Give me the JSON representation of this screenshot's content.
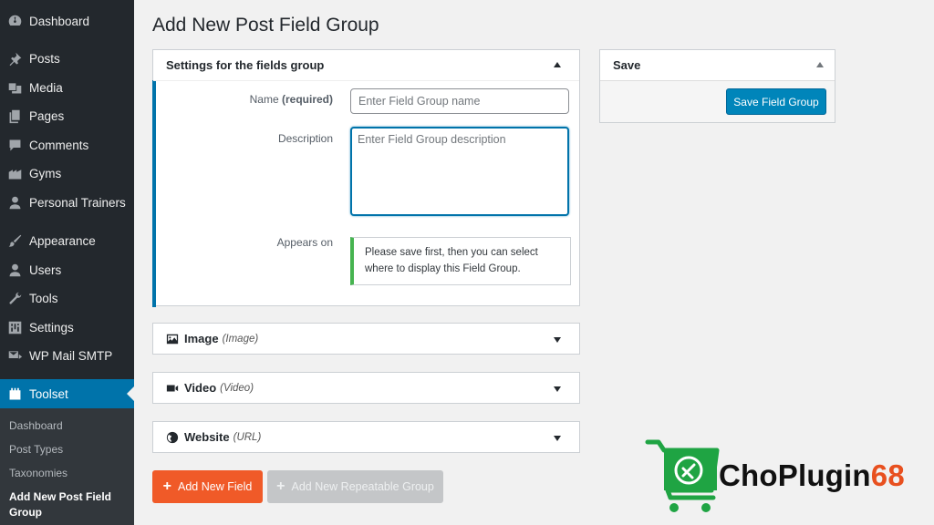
{
  "sidebar": {
    "items": [
      {
        "label": "Dashboard",
        "icon": "dashboard-icon"
      },
      {
        "label": "Posts",
        "icon": "pin-icon"
      },
      {
        "label": "Media",
        "icon": "media-icon"
      },
      {
        "label": "Pages",
        "icon": "pages-icon"
      },
      {
        "label": "Comments",
        "icon": "comments-icon"
      },
      {
        "label": "Gyms",
        "icon": "building-icon"
      },
      {
        "label": "Personal Trainers",
        "icon": "user-icon"
      },
      {
        "label": "Appearance",
        "icon": "brush-icon"
      },
      {
        "label": "Users",
        "icon": "users-icon"
      },
      {
        "label": "Tools",
        "icon": "wrench-icon"
      },
      {
        "label": "Settings",
        "icon": "settings-icon"
      },
      {
        "label": "WP Mail SMTP",
        "icon": "mail-icon"
      },
      {
        "label": "Toolset",
        "icon": "toolset-icon"
      }
    ],
    "submenu": [
      {
        "label": "Dashboard"
      },
      {
        "label": "Post Types"
      },
      {
        "label": "Taxonomies"
      },
      {
        "label": "Add New Post Field Group"
      }
    ],
    "active_color": "#0073aa"
  },
  "page": {
    "title": "Add New Post Field Group"
  },
  "settings_box": {
    "title": "Settings for the fields group",
    "name_label": "Name",
    "name_required": "(required)",
    "name_placeholder": "Enter Field Group name",
    "description_label": "Description",
    "description_placeholder": "Enter Field Group description",
    "appears_on_label": "Appears on",
    "appears_on_notice": "Please save first, then you can select where to display this Field Group."
  },
  "fields": [
    {
      "label": "Image",
      "type": "(Image)",
      "icon": "image-icon"
    },
    {
      "label": "Video",
      "type": "(Video)",
      "icon": "video-camera-icon"
    },
    {
      "label": "Website",
      "type": "(URL)",
      "icon": "globe-icon"
    }
  ],
  "save_box": {
    "title": "Save",
    "button": "Save Field Group"
  },
  "actions": {
    "add_field": "Add New Field",
    "add_repeatable": "Add New Repeatable Group",
    "primary_color": "#f05a28"
  },
  "watermark": {
    "text_part1": "ChoPlugin",
    "text_part2": "68",
    "color_green": "#1fa443",
    "color_orange": "#e8501f"
  }
}
